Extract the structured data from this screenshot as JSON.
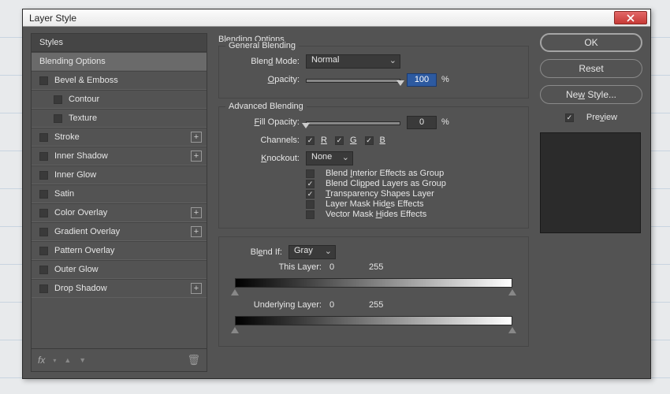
{
  "window": {
    "title": "Layer Style"
  },
  "left": {
    "header": "Styles",
    "items": [
      {
        "label": "Blending Options",
        "checkable": false,
        "selected": true
      },
      {
        "label": "Bevel & Emboss",
        "checkable": true,
        "checked": false,
        "add": false
      },
      {
        "label": "Contour",
        "checkable": true,
        "checked": false,
        "indent": true
      },
      {
        "label": "Texture",
        "checkable": true,
        "checked": false,
        "indent": true
      },
      {
        "label": "Stroke",
        "checkable": true,
        "checked": false,
        "add": true
      },
      {
        "label": "Inner Shadow",
        "checkable": true,
        "checked": false,
        "add": true
      },
      {
        "label": "Inner Glow",
        "checkable": true,
        "checked": false
      },
      {
        "label": "Satin",
        "checkable": true,
        "checked": false
      },
      {
        "label": "Color Overlay",
        "checkable": true,
        "checked": false,
        "add": true
      },
      {
        "label": "Gradient Overlay",
        "checkable": true,
        "checked": false,
        "add": true
      },
      {
        "label": "Pattern Overlay",
        "checkable": true,
        "checked": false
      },
      {
        "label": "Outer Glow",
        "checkable": true,
        "checked": false
      },
      {
        "label": "Drop Shadow",
        "checkable": true,
        "checked": false,
        "add": true
      }
    ],
    "footer_fx": "fx"
  },
  "main": {
    "title": "Blending Options",
    "general": {
      "legend": "General Blending",
      "blend_mode_label": "Blend Mode:",
      "blend_mode_value": "Normal",
      "opacity_label": "Opacity:",
      "opacity_value": "100",
      "pct": "%"
    },
    "advanced": {
      "legend": "Advanced Blending",
      "fill_opacity_label": "Fill Opacity:",
      "fill_opacity_value": "0",
      "pct": "%",
      "channels_label": "Channels:",
      "ch_r": "R",
      "ch_g": "G",
      "ch_b": "B",
      "knockout_label": "Knockout:",
      "knockout_value": "None",
      "opt1": "Blend Interior Effects as Group",
      "opt2": "Blend Clipped Layers as Group",
      "opt3": "Transparency Shapes Layer",
      "opt4": "Layer Mask Hides Effects",
      "opt5": "Vector Mask Hides Effects"
    },
    "blendif": {
      "label": "Blend If:",
      "value": "Gray",
      "this_layer_label": "This Layer:",
      "this_low": "0",
      "this_high": "255",
      "under_label": "Underlying Layer:",
      "under_low": "0",
      "under_high": "255"
    }
  },
  "right": {
    "ok": "OK",
    "reset": "Reset",
    "new_style": "New Style...",
    "preview_label": "Preview"
  }
}
